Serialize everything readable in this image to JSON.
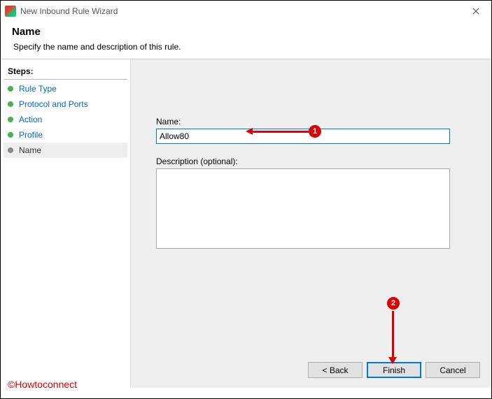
{
  "window": {
    "title": "New Inbound Rule Wizard"
  },
  "header": {
    "title": "Name",
    "subtitle": "Specify the name and description of this rule."
  },
  "sidebar": {
    "header": "Steps:",
    "items": [
      {
        "label": "Rule Type"
      },
      {
        "label": "Protocol and Ports"
      },
      {
        "label": "Action"
      },
      {
        "label": "Profile"
      },
      {
        "label": "Name"
      }
    ]
  },
  "form": {
    "name_label": "Name:",
    "name_value": "Allow80",
    "description_label": "Description (optional):",
    "description_value": ""
  },
  "buttons": {
    "back": "< Back",
    "finish": "Finish",
    "cancel": "Cancel"
  },
  "annotations": {
    "callout1": "1",
    "callout2": "2"
  },
  "watermark": "©Howtoconnect"
}
